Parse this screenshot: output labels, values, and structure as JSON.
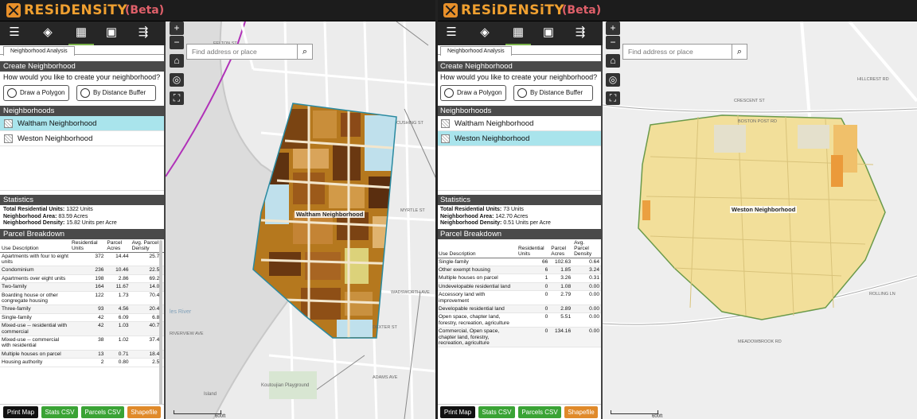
{
  "left": {
    "app_name": "RESiDENSiTY",
    "app_badge": "(Beta)",
    "tab": "Neighborhood Analysis",
    "create_header": "Create Neighborhood",
    "create_question": "How would you like to create your neighborhood?",
    "draw_button": "Draw a Polygon",
    "buffer_button": "By Distance Buffer",
    "neighborhoods_header": "Neighborhoods",
    "neighborhoods": [
      "Waltham Neighborhood",
      "Weston Neighborhood"
    ],
    "selected_index": 0,
    "statistics_header": "Statistics",
    "stats": {
      "units_label": "Total Residential Units:",
      "units_value": "1322 Units",
      "area_label": "Neighborhood Area:",
      "area_value": "83.59 Acres",
      "density_label": "Neighborhood Density:",
      "density_value": "15.82 Units per Acre"
    },
    "parcel_header": "Parcel Breakdown",
    "columns": [
      "Use Description",
      "Residential Units",
      "Parcel Acres",
      "Avg. Parcel Density"
    ],
    "rows": [
      [
        "Apartments with four to eight units",
        "372",
        "14.44",
        "25.76"
      ],
      [
        "Condominium",
        "236",
        "10.46",
        "22.57"
      ],
      [
        "Apartments over eight units",
        "198",
        "2.86",
        "69.22"
      ],
      [
        "Two-family",
        "164",
        "11.67",
        "14.05"
      ],
      [
        "Boarding house or other congregate housing",
        "122",
        "1.73",
        "70.41"
      ],
      [
        "Three-family",
        "93",
        "4.56",
        "20.40"
      ],
      [
        "Single-family",
        "42",
        "6.09",
        "6.89"
      ],
      [
        "Mixed-use -- residential with commercial",
        "42",
        "1.03",
        "40.74"
      ],
      [
        "Mixed-use -- commercial with residential",
        "38",
        "1.02",
        "37.41"
      ],
      [
        "Multiple houses on parcel",
        "13",
        "0.71",
        "18.40"
      ],
      [
        "Housing authority",
        "2",
        "0.80",
        "2.51"
      ]
    ],
    "search_placeholder": "Find address or place",
    "map_label": "Waltham Neighborhood",
    "streets": [
      "FELTON ST",
      "CUSHING ST",
      "MYRTLE ST",
      "WADSWORTH AVE",
      "DEXTER ST",
      "ADAMS AVE",
      "RIVERVIEW AVE"
    ],
    "water_label": "les River",
    "park_label": "Koutoujian Playground",
    "island_label": "Island",
    "scale": "600ft"
  },
  "right": {
    "app_name": "RESiDENSiTY",
    "app_badge": "(Beta)",
    "tab": "Neighborhood Analysis",
    "create_header": "Create Neighborhood",
    "create_question": "How would you like to create your neighborhood?",
    "draw_button": "Draw a Polygon",
    "buffer_button": "By Distance Buffer",
    "neighborhoods_header": "Neighborhoods",
    "neighborhoods": [
      "Waltham Neighborhood",
      "Weston Neighborhood"
    ],
    "selected_index": 1,
    "statistics_header": "Statistics",
    "stats": {
      "units_label": "Total Residential Units:",
      "units_value": "73 Units",
      "area_label": "Neighborhood Area:",
      "area_value": "142.70 Acres",
      "density_label": "Neighborhood Density:",
      "density_value": "0.51 Units per Acre"
    },
    "parcel_header": "Parcel Breakdown",
    "columns": [
      "Use Description",
      "Residential Units",
      "Parcel Acres",
      "Avg. Parcel Density"
    ],
    "rows": [
      [
        "Single-family",
        "66",
        "102.63",
        "0.64"
      ],
      [
        "Other exempt housing",
        "6",
        "1.85",
        "3.24"
      ],
      [
        "Multiple houses on parcel",
        "1",
        "3.26",
        "0.31"
      ],
      [
        "Undevelopable residential land",
        "0",
        "1.08",
        "0.00"
      ],
      [
        "Accessory land with improvement",
        "0",
        "2.79",
        "0.00"
      ],
      [
        "Developable residential land",
        "0",
        "2.89",
        "0.00"
      ],
      [
        "Open space, chapter land, forestry, recreation, agriculture",
        "0",
        "5.51",
        "0.00"
      ],
      [
        "Commercial, Open space, chapter land, forestry, recreation, agriculture",
        "0",
        "134.16",
        "0.00"
      ]
    ],
    "search_placeholder": "Find address or place",
    "map_label": "Weston Neighborhood",
    "streets": [
      "HILLCREST RD",
      "CRESCENT ST",
      "BOSTON POST RD",
      "MEADOWBROOK RD",
      "ROLLING LN"
    ],
    "scale": "600ft"
  },
  "footer": {
    "print": "Print Map",
    "stats_csv": "Stats CSV",
    "parcels_csv": "Parcels CSV",
    "shapefile": "Shapefile"
  },
  "colors": {
    "accent": "#f0a030",
    "selected": "#a9e4ec",
    "print": "#111111",
    "csv": "#3aa335",
    "shapefile": "#e08a2a",
    "header": "#4a4a4a"
  }
}
